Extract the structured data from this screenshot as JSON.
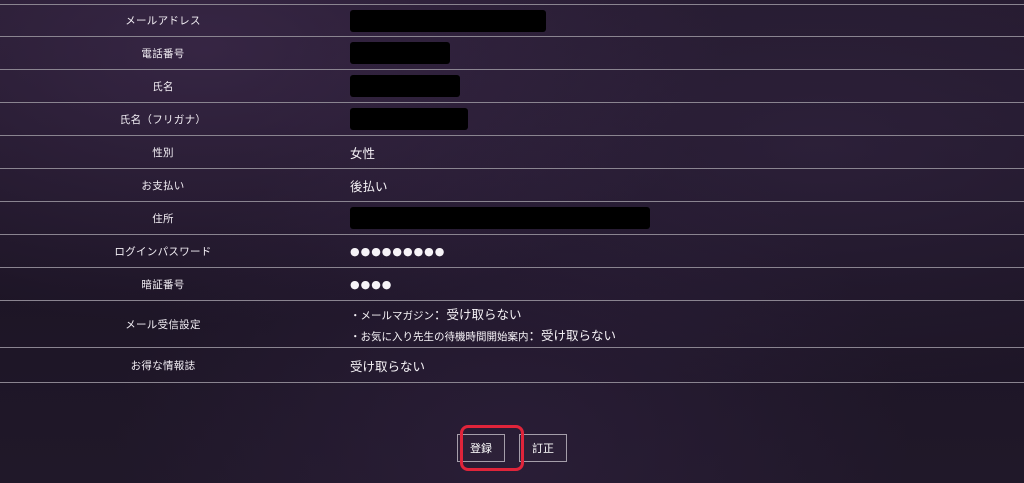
{
  "form": {
    "rows": [
      {
        "label": "メールアドレス",
        "value": ""
      },
      {
        "label": "電話番号",
        "value": ""
      },
      {
        "label": "氏名",
        "value": ""
      },
      {
        "label": "氏名（フリガナ）",
        "value": ""
      },
      {
        "label": "性別",
        "value": "女性"
      },
      {
        "label": "お支払い",
        "value": "後払い"
      },
      {
        "label": "住所",
        "value": ""
      },
      {
        "label": "ログインパスワード",
        "value": "●●●●●●●●●"
      },
      {
        "label": "暗証番号",
        "value": "●●●●"
      },
      {
        "label": "メール受信設定",
        "sub": [
          {
            "prefix": "・メールマガジン",
            "value": "：受け取らない"
          },
          {
            "prefix": "・お気に入り先生の待機時間開始案内",
            "value": "：受け取らない"
          }
        ]
      },
      {
        "label": "お得な情報誌",
        "value": "受け取らない"
      }
    ]
  },
  "actions": {
    "register_label": "登録",
    "correct_label": "訂正"
  },
  "colors": {
    "highlight": "#e0243a",
    "divider": "#8a8490",
    "background": "#1f1727"
  }
}
